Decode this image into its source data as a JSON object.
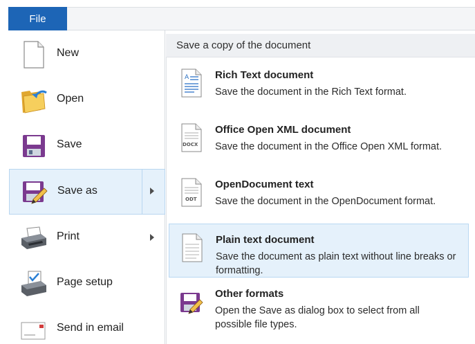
{
  "file_tab": {
    "label": "File"
  },
  "left_menu": {
    "items": [
      {
        "label": "New",
        "icon": "new-document-icon"
      },
      {
        "label": "Open",
        "icon": "open-folder-icon"
      },
      {
        "label": "Save",
        "icon": "save-disk-icon"
      },
      {
        "label": "Save as",
        "icon": "save-as-icon",
        "selected": true,
        "has_arrow": true
      },
      {
        "label": "Print",
        "icon": "printer-icon",
        "has_arrow": true
      },
      {
        "label": "Page setup",
        "icon": "page-setup-icon"
      },
      {
        "label": "Send in email",
        "icon": "email-icon"
      }
    ]
  },
  "submenu": {
    "header": "Save a copy of the document",
    "items": [
      {
        "title": "Rich Text document",
        "description": "Save the document in the Rich Text format.",
        "icon": "rtf-document-icon"
      },
      {
        "title": "Office Open XML document",
        "description": "Save the document in the Office Open XML format.",
        "icon": "docx-document-icon",
        "badge": "DOCX"
      },
      {
        "title": "OpenDocument text",
        "description": "Save the document in the OpenDocument format.",
        "icon": "odt-document-icon",
        "badge": "ODT"
      },
      {
        "title": "Plain text document",
        "description": "Save the document as plain text without line breaks or formatting.",
        "icon": "plain-text-icon",
        "hover": true
      },
      {
        "title": "Other formats",
        "description": "Open the Save as dialog box to select from all possible file types.",
        "icon": "save-as-icon"
      }
    ]
  },
  "colors": {
    "file_tab_bg": "#1d65b6",
    "selected_bg": "#e5f1fb",
    "selected_border": "#b8d6f0"
  }
}
